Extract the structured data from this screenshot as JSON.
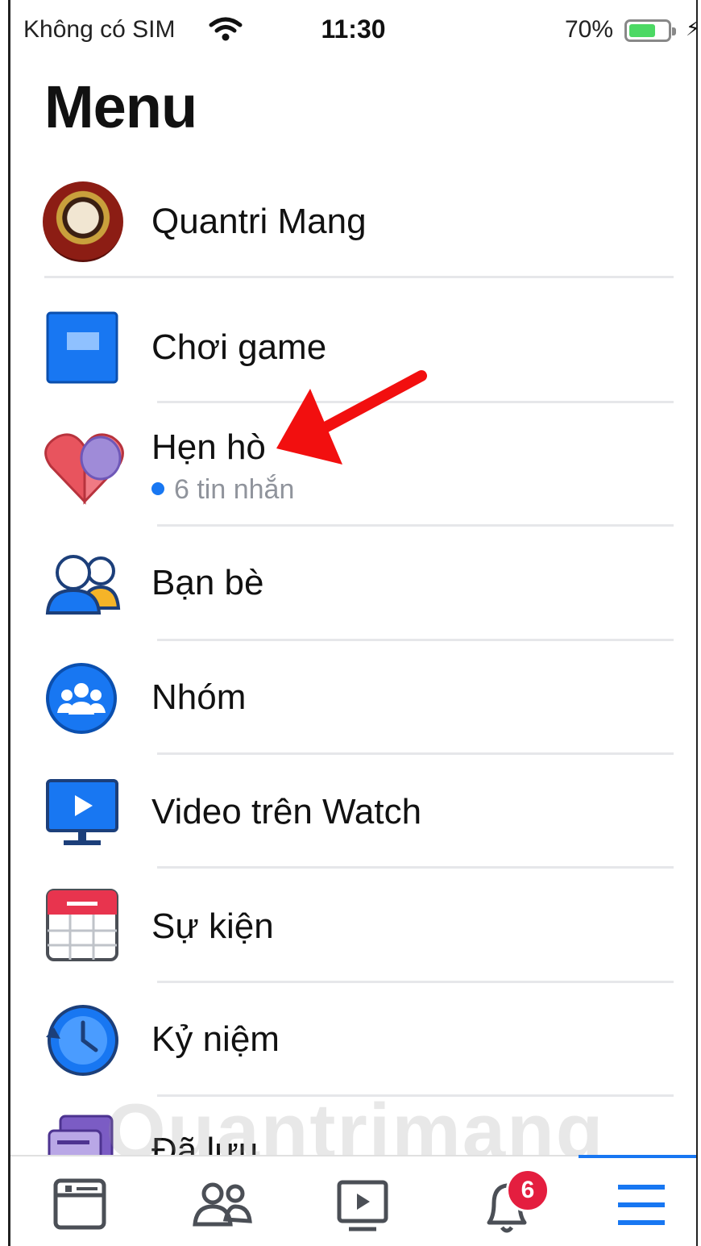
{
  "status_bar": {
    "carrier": "Không có SIM",
    "time": "11:30",
    "battery_percent": "70%",
    "battery_level": 0.7
  },
  "title": "Menu",
  "profile": {
    "name": "Quantri Mang"
  },
  "menu_items": [
    {
      "label": "Chơi game",
      "icon": "game-icon"
    },
    {
      "label": "Hẹn hò",
      "sub": "6 tin nhắn",
      "icon": "heart-icon"
    },
    {
      "label": "Bạn bè",
      "icon": "friends-icon"
    },
    {
      "label": "Nhóm",
      "icon": "groups-icon"
    },
    {
      "label": "Video trên Watch",
      "icon": "watch-icon"
    },
    {
      "label": "Sự kiện",
      "icon": "calendar-icon"
    },
    {
      "label": "Kỷ niệm",
      "icon": "memories-icon"
    },
    {
      "label": "Đã lưu",
      "icon": "saved-icon"
    }
  ],
  "tabbar": {
    "tabs": [
      "news-feed-icon",
      "friends-tab-icon",
      "watch-tab-icon",
      "notifications-icon",
      "menu-icon"
    ],
    "notification_count": "6",
    "active": "menu-icon"
  },
  "watermark": "Quantrimang",
  "colors": {
    "accent": "#1877f2",
    "badge": "#e41e3f",
    "arrow": "#f20f0f"
  }
}
